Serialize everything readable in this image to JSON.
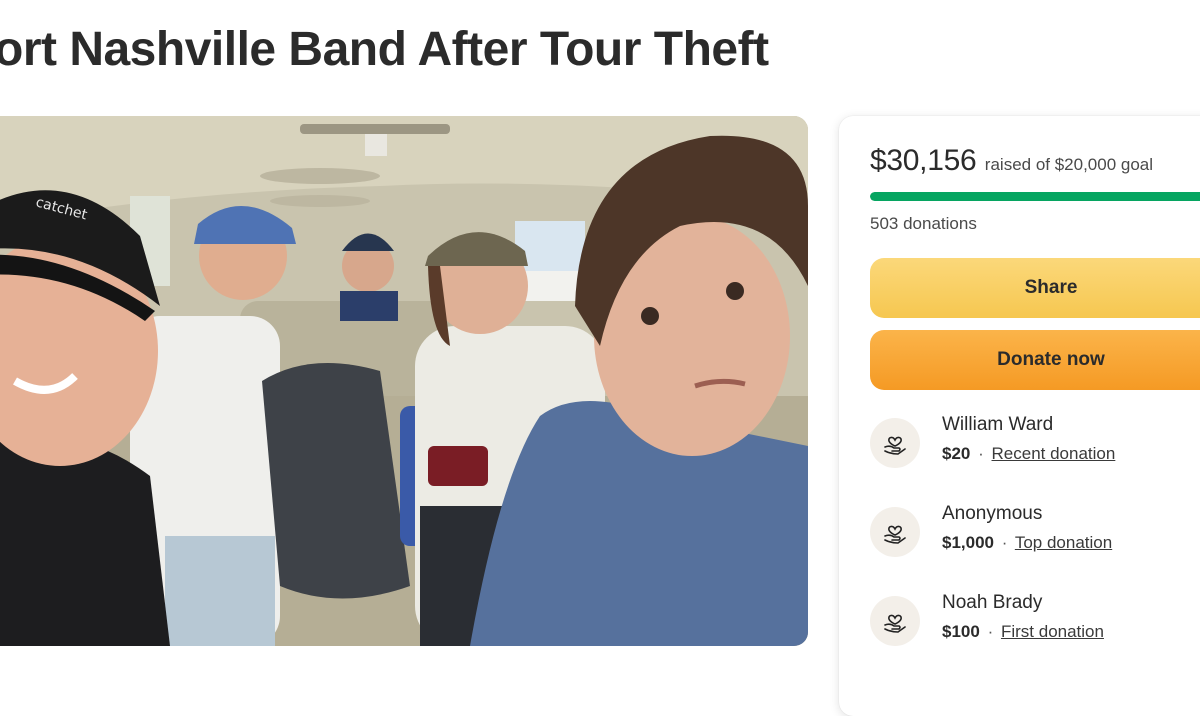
{
  "campaign": {
    "title": "ort Nashville Band After Tour Theft"
  },
  "hero_image": {
    "icon": "band-photo-image"
  },
  "fundraiser": {
    "raised": "$30,156",
    "goal_text": "raised of $20,000 goal",
    "progress_fraction": 1.0,
    "donations_count": "503 donations",
    "share_label": "Share",
    "donate_label": "Donate now",
    "colors": {
      "progress": "#06a561",
      "share": "#f8cf63",
      "donate": "#f8a733"
    }
  },
  "donors": [
    {
      "name": "William Ward",
      "amount": "$20",
      "separator": "·",
      "tag": "Recent donation",
      "icon": "heart-hand-icon"
    },
    {
      "name": "Anonymous",
      "amount": "$1,000",
      "separator": "·",
      "tag": "Top donation",
      "icon": "heart-hand-icon"
    },
    {
      "name": "Noah Brady",
      "amount": "$100",
      "separator": "·",
      "tag": "First donation",
      "icon": "heart-hand-icon"
    }
  ]
}
